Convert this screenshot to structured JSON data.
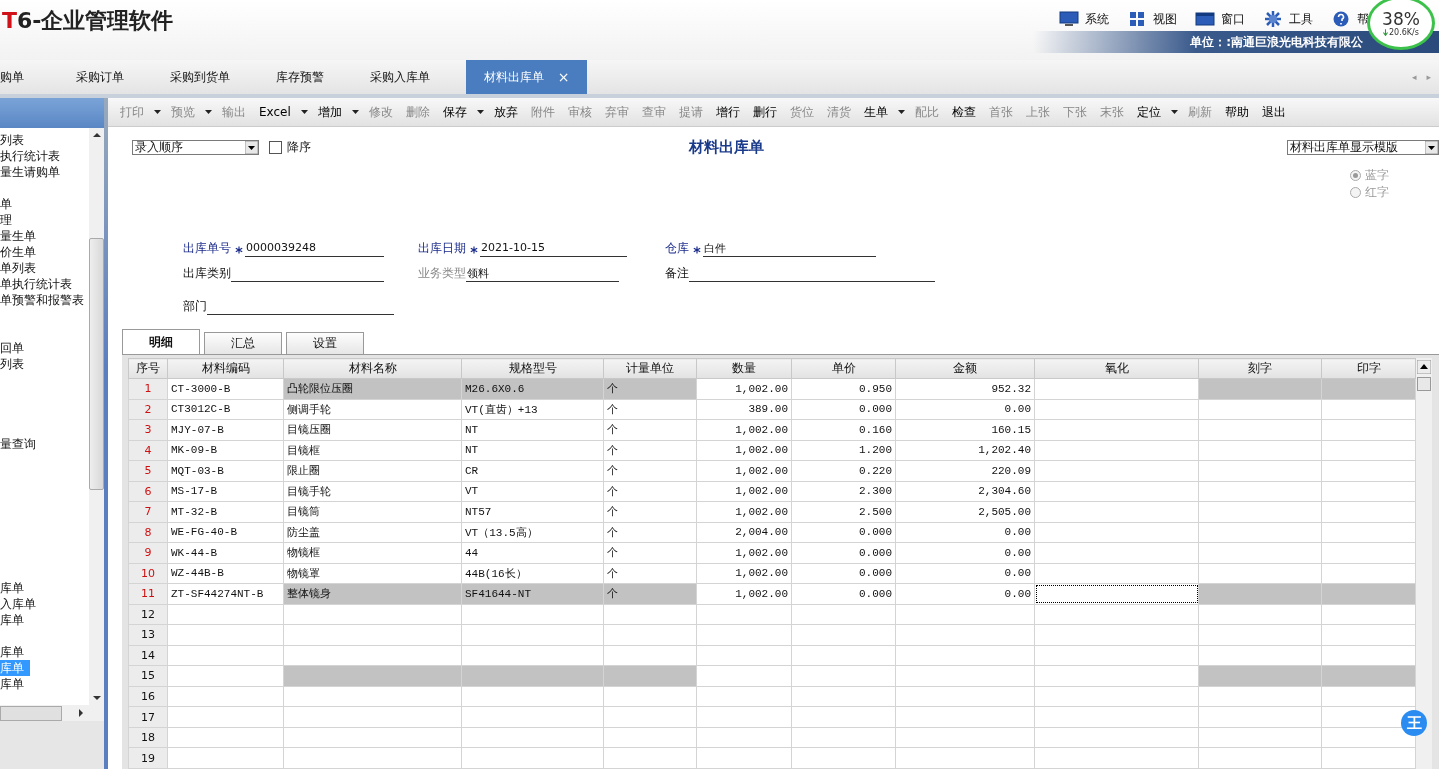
{
  "app": {
    "logo_mark": "T",
    "logo_text": "6-企业管理软件"
  },
  "menu": [
    {
      "label": "系统"
    },
    {
      "label": "视图"
    },
    {
      "label": "窗口"
    },
    {
      "label": "工具"
    },
    {
      "label": "帮"
    }
  ],
  "unit": "单位：:南通巨浪光电科技有限公",
  "net_meter": {
    "percent": "38%",
    "speed": "20.6K/s"
  },
  "tabs": [
    {
      "label": "购单",
      "selected": false
    },
    {
      "label": "采购订单",
      "selected": false
    },
    {
      "label": "采购到货单",
      "selected": false
    },
    {
      "label": "库存预警",
      "selected": false
    },
    {
      "label": "采购入库单",
      "selected": false
    },
    {
      "label": "材料出库单",
      "selected": true,
      "close": "×"
    }
  ],
  "tab_nav": [
    "◂",
    "▸"
  ],
  "sidebar": {
    "groups": [
      [
        {
          "label": "列表",
          "selected": false
        },
        {
          "label": "执行统计表",
          "selected": false
        },
        {
          "label": "量生请购单",
          "selected": false
        }
      ],
      [
        {
          "label": "单",
          "selected": false
        },
        {
          "label": "理",
          "selected": false
        },
        {
          "label": "量生单",
          "selected": false
        },
        {
          "label": "价生单",
          "selected": false
        },
        {
          "label": "单列表",
          "selected": false
        },
        {
          "label": "单执行统计表",
          "selected": false
        },
        {
          "label": "单预警和报警表",
          "selected": false
        }
      ],
      [
        {
          "label": "回单",
          "selected": false
        },
        {
          "label": "列表",
          "selected": false
        }
      ],
      [
        {
          "label": "量查询",
          "selected": false
        }
      ],
      [
        {
          "label": "库单",
          "selected": false
        },
        {
          "label": "入库单",
          "selected": false
        },
        {
          "label": "库单",
          "selected": false
        }
      ],
      [
        {
          "label": "库单",
          "selected": false
        },
        {
          "label": "库单",
          "selected": true
        },
        {
          "label": "库单",
          "selected": false
        }
      ]
    ]
  },
  "toolbar": [
    {
      "label": "打印",
      "disabled": true,
      "dropdown": true
    },
    {
      "label": "预览",
      "disabled": true,
      "dropdown": true
    },
    {
      "label": "输出",
      "disabled": true,
      "dropdown": false
    },
    {
      "label": "Excel",
      "disabled": false,
      "dropdown": true
    },
    {
      "label": "增加",
      "disabled": false,
      "dropdown": true
    },
    {
      "label": "修改",
      "disabled": true,
      "dropdown": false
    },
    {
      "label": "删除",
      "disabled": true,
      "dropdown": false
    },
    {
      "label": "保存",
      "disabled": false,
      "dropdown": true
    },
    {
      "label": "放弃",
      "disabled": false,
      "dropdown": false
    },
    {
      "label": "附件",
      "disabled": true,
      "dropdown": false
    },
    {
      "label": "审核",
      "disabled": true,
      "dropdown": false
    },
    {
      "label": "弃审",
      "disabled": true,
      "dropdown": false
    },
    {
      "label": "查审",
      "disabled": true,
      "dropdown": false
    },
    {
      "label": "提请",
      "disabled": true,
      "dropdown": false
    },
    {
      "label": "增行",
      "disabled": false,
      "dropdown": false
    },
    {
      "label": "删行",
      "disabled": false,
      "dropdown": false
    },
    {
      "label": "货位",
      "disabled": true,
      "dropdown": false
    },
    {
      "label": "清货",
      "disabled": true,
      "dropdown": false
    },
    {
      "label": "生单",
      "disabled": false,
      "dropdown": true
    },
    {
      "label": "配比",
      "disabled": true,
      "dropdown": false
    },
    {
      "label": "检查",
      "disabled": false,
      "dropdown": false
    },
    {
      "label": "首张",
      "disabled": true,
      "dropdown": false
    },
    {
      "label": "上张",
      "disabled": true,
      "dropdown": false
    },
    {
      "label": "下张",
      "disabled": true,
      "dropdown": false
    },
    {
      "label": "末张",
      "disabled": true,
      "dropdown": false
    },
    {
      "label": "定位",
      "disabled": false,
      "dropdown": true
    },
    {
      "label": "刷新",
      "disabled": true,
      "dropdown": false
    },
    {
      "label": "帮助",
      "disabled": false,
      "dropdown": false
    },
    {
      "label": "退出",
      "disabled": false,
      "dropdown": false
    }
  ],
  "form": {
    "sort_select": "录入顺序",
    "descending": {
      "label": "降序",
      "checked": false
    },
    "title": "材料出库单",
    "template_select": "材料出库单显示模版",
    "radios": [
      {
        "label": "蓝字",
        "selected": true
      },
      {
        "label": "红字",
        "selected": false
      }
    ],
    "field_rows": [
      [
        {
          "label": "出库单号",
          "required": true,
          "disabled": false,
          "value": "0000039248"
        },
        {
          "label": "出库日期",
          "required": true,
          "disabled": false,
          "value": "2021-10-15"
        },
        {
          "label": "仓库",
          "required": true,
          "disabled": false,
          "value": "白件"
        }
      ],
      [
        {
          "label": "出库类别",
          "required": false,
          "disabled": false
        },
        {
          "label": "业务类型",
          "required": false,
          "disabled": true,
          "value": "领料"
        },
        {
          "label": "备注",
          "required": false,
          "disabled": false
        }
      ],
      [
        {
          "label": "部门",
          "required": false,
          "disabled": false
        }
      ]
    ]
  },
  "detail_tabs": [
    {
      "label": "明细",
      "selected": true
    },
    {
      "label": "汇总",
      "selected": false
    },
    {
      "label": "设置",
      "selected": false
    }
  ],
  "grid": {
    "columns": [
      "序号",
      "材料编码",
      "材料名称",
      "规格型号",
      "计量单位",
      "数量",
      "单价",
      "金额",
      "氧化",
      "刻字",
      "印字"
    ],
    "rows": [
      {
        "no": "1",
        "shaded": true,
        "focused": false,
        "cells": [
          "CT-3000-B",
          "凸轮限位压圈",
          "M26.6X0.6",
          "个",
          "1,002.00",
          "0.950",
          "952.32"
        ]
      },
      {
        "no": "2",
        "shaded": false,
        "focused": false,
        "cells": [
          "CT3012C-B",
          "侧调手轮",
          "VT(直齿）+13",
          "个",
          "389.00",
          "0.000",
          "0.00"
        ]
      },
      {
        "no": "3",
        "shaded": false,
        "focused": false,
        "cells": [
          "MJY-07-B",
          "目镜压圈",
          "NT",
          "个",
          "1,002.00",
          "0.160",
          "160.15"
        ]
      },
      {
        "no": "4",
        "shaded": false,
        "focused": false,
        "cells": [
          "MK-09-B",
          "目镜框",
          "NT",
          "个",
          "1,002.00",
          "1.200",
          "1,202.40"
        ]
      },
      {
        "no": "5",
        "shaded": false,
        "focused": false,
        "cells": [
          "MQT-03-B",
          "限止圈",
          "CR",
          "个",
          "1,002.00",
          "0.220",
          "220.09"
        ]
      },
      {
        "no": "6",
        "shaded": false,
        "focused": false,
        "cells": [
          "MS-17-B",
          "目镜手轮",
          "VT",
          "个",
          "1,002.00",
          "2.300",
          "2,304.60"
        ]
      },
      {
        "no": "7",
        "shaded": false,
        "focused": false,
        "cells": [
          "MT-32-B",
          "目镜筒",
          "NT57",
          "个",
          "1,002.00",
          "2.500",
          "2,505.00"
        ]
      },
      {
        "no": "8",
        "shaded": false,
        "focused": false,
        "cells": [
          "WE-FG-40-B",
          "防尘盖",
          "VT（13.5高）",
          "个",
          "2,004.00",
          "0.000",
          "0.00"
        ]
      },
      {
        "no": "9",
        "shaded": false,
        "focused": false,
        "cells": [
          "WK-44-B",
          "物镜框",
          "44",
          "个",
          "1,002.00",
          "0.000",
          "0.00"
        ]
      },
      {
        "no": "10",
        "shaded": false,
        "focused": false,
        "cells": [
          "WZ-44B-B",
          "物镜罩",
          "44B(16长）",
          "个",
          "1,002.00",
          "0.000",
          "0.00"
        ]
      },
      {
        "no": "11",
        "shaded": true,
        "focused": true,
        "cells": [
          "ZT-SF44274NT-B",
          "整体镜身",
          "SF41644-NT",
          "个",
          "1,002.00",
          "0.000",
          "0.00"
        ]
      },
      {
        "no": "12",
        "shaded": false,
        "focused": false
      },
      {
        "no": "13",
        "shaded": false,
        "focused": false
      },
      {
        "no": "14",
        "shaded": false,
        "focused": false
      },
      {
        "no": "15",
        "shaded": true,
        "focused": false
      },
      {
        "no": "16",
        "shaded": false,
        "focused": false
      },
      {
        "no": "17",
        "shaded": false,
        "focused": false
      },
      {
        "no": "18",
        "shaded": false,
        "focused": false
      },
      {
        "no": "19",
        "shaded": false,
        "focused": false
      }
    ]
  },
  "float_badge": "王"
}
